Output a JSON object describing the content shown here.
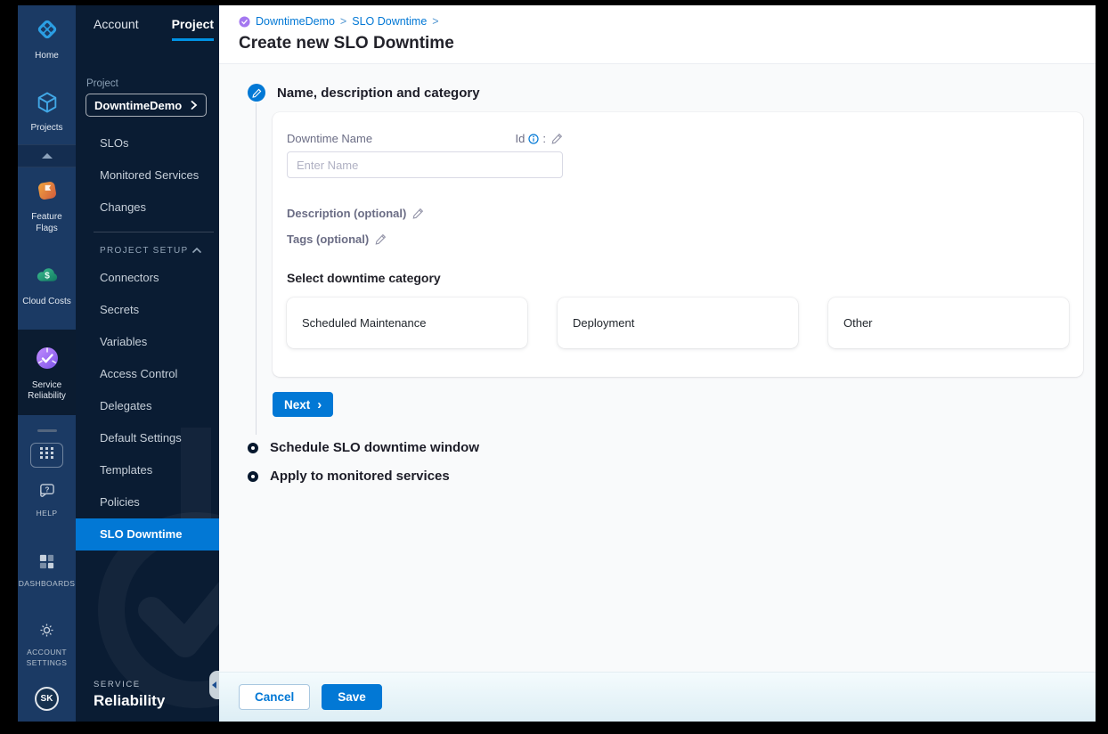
{
  "colors": {
    "accent": "#0278d5",
    "tab_underline": "#0092e4",
    "rail_bg": "#1b3a64",
    "rail_active_bg": "#0b1c31",
    "sidebar_bg": "#0a1c33",
    "active_nav_bg": "#0278d5",
    "content_bg": "#f9fafb",
    "step_ring": "#07182e",
    "footer_gradient": [
      "#f4fbfd",
      "#ddeef5"
    ]
  },
  "rail": {
    "items": [
      {
        "label": "Home",
        "icon": "home-icon"
      },
      {
        "label": "Projects",
        "icon": "projects-icon"
      },
      {
        "label": "Feature Flags",
        "icon": "feature-flags-icon"
      },
      {
        "label": "Cloud Costs",
        "icon": "cloud-costs-icon"
      },
      {
        "label": "Service Reliability",
        "icon": "service-reliability-icon"
      }
    ],
    "bottom_items": [
      {
        "label": "HELP",
        "icon": "help-icon"
      },
      {
        "label": "DASHBOARDS",
        "icon": "dashboards-icon"
      },
      {
        "label": "ACCOUNT SETTINGS",
        "icon": "gear-icon"
      }
    ],
    "avatar_initials": "SK"
  },
  "sidebar": {
    "tabs": {
      "account": "Account",
      "project": "Project"
    },
    "project_label": "Project",
    "project_name": "DowntimeDemo",
    "nav_top": [
      "SLOs",
      "Monitored Services",
      "Changes"
    ],
    "section_header": "PROJECT SETUP",
    "nav_setup": [
      "Connectors",
      "Secrets",
      "Variables",
      "Access Control",
      "Delegates",
      "Default Settings",
      "Templates",
      "Policies"
    ],
    "active_item": "SLO Downtime",
    "module_kicker": "SERVICE",
    "module_name": "Reliability"
  },
  "header": {
    "breadcrumb": {
      "crumb1": "DowntimeDemo",
      "crumb2": "SLO Downtime",
      "separator": ">"
    },
    "title": "Create new SLO Downtime"
  },
  "wizard": {
    "step1_title": "Name, description and category",
    "step2_title": "Schedule SLO downtime window",
    "step3_title": "Apply to monitored services",
    "next_label": "Next",
    "next_chevron": "›"
  },
  "form": {
    "name_label": "Downtime Name",
    "id_label": "Id",
    "id_colon": ":",
    "name_placeholder": "Enter Name",
    "description_label": "Description (optional)",
    "tags_label": "Tags (optional)",
    "category_heading": "Select downtime category",
    "categories": [
      "Scheduled Maintenance",
      "Deployment",
      "Other"
    ]
  },
  "footer": {
    "cancel_label": "Cancel",
    "save_label": "Save"
  }
}
